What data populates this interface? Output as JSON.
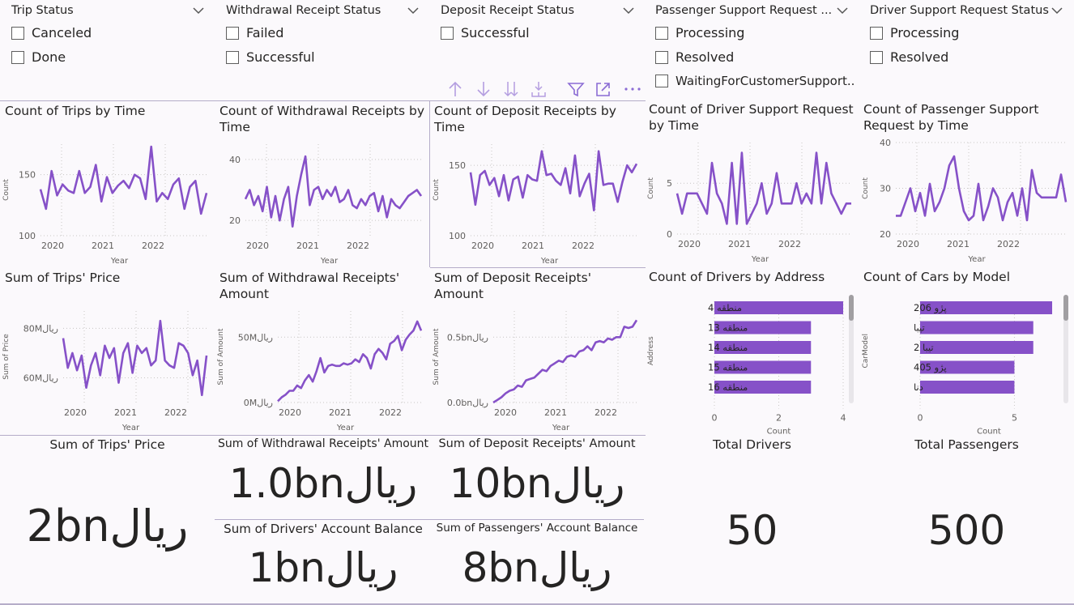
{
  "colors": {
    "accent": "#8651c8",
    "grid": "#c8c6c4",
    "text": "#605e5c",
    "divider": "#b5adc9"
  },
  "slicers": [
    {
      "title": "Trip Status",
      "options": [
        "Canceled",
        "Done"
      ]
    },
    {
      "title": "Withdrawal Receipt Status",
      "options": [
        "Failed",
        "Successful"
      ]
    },
    {
      "title": "Deposit Receipt Status",
      "options": [
        "Successful"
      ]
    },
    {
      "title": "Passenger Support Request ...",
      "options": [
        "Processing",
        "Resolved",
        "WaitingForCustomerSupport..."
      ]
    },
    {
      "title": "Driver Support Request Status",
      "options": [
        "Processing",
        "Resolved"
      ]
    }
  ],
  "toolbar_icons": [
    "arrow-up-icon",
    "arrow-down-icon",
    "double-arrow-down-icon",
    "expand-hierarchy-icon",
    "filter-icon",
    "focus-mode-icon",
    "more-options-icon"
  ],
  "visual_titles": {
    "trips_time": "Count of Trips by Time",
    "withdrawal_time": "Count of Withdrawal Receipts by Time",
    "deposit_time": "Count of Deposit Receipts by Time",
    "driver_support_time": "Count of Driver Support Request by Time",
    "passenger_support_time": "Count of Passenger Support Request by Time",
    "trips_price": "Sum of Trips' Price",
    "withdrawal_amount": "Sum of Withdrawal Receipts' Amount",
    "deposit_amount": "Sum of Deposit Receipts' Amount",
    "drivers_address": "Count of Drivers by Address",
    "cars_model": "Count of Cars by Model"
  },
  "cards": [
    {
      "title": "Sum of Trips' Price",
      "value": "2bnریال"
    },
    {
      "title": "Sum of Withdrawal Receipts' Amount",
      "value": "1.0bnریال"
    },
    {
      "title": "Sum of Deposit Receipts' Amount",
      "value": "10bnریال"
    },
    {
      "title": "Sum of Drivers' Account Balance",
      "value": "1bnریال"
    },
    {
      "title": "Sum of Passengers' Account Balance",
      "value": "8bnریال"
    },
    {
      "title": "Total Drivers",
      "value": "50"
    },
    {
      "title": "Total Passengers",
      "value": "500"
    }
  ],
  "chart_data": [
    {
      "type": "line",
      "title": "Count of Trips by Time",
      "xlabel": "Year",
      "ylabel": "Count",
      "x_ticks": [
        "2020",
        "2021",
        "2022"
      ],
      "y_ticks": [
        "100",
        "150"
      ],
      "ylim": [
        100,
        175
      ],
      "values": [
        138,
        122,
        153,
        133,
        142,
        137,
        135,
        153,
        135,
        140,
        158,
        128,
        148,
        135,
        141,
        145,
        139,
        150,
        147,
        130,
        173,
        128,
        135,
        130,
        142,
        147,
        122,
        140,
        145,
        118,
        135
      ]
    },
    {
      "type": "line",
      "title": "Count of Withdrawal Receipts by Time",
      "xlabel": "Year",
      "ylabel": "",
      "x_ticks": [
        "2020",
        "2021",
        "2022"
      ],
      "y_ticks": [
        "20",
        "40"
      ],
      "ylim": [
        15,
        45
      ],
      "values": [
        27,
        30,
        25,
        28,
        23,
        31,
        21,
        28,
        20,
        27,
        31,
        18,
        28,
        35,
        41,
        25,
        30,
        31,
        27,
        30,
        28,
        31,
        26,
        27,
        30,
        25,
        24,
        27,
        25,
        28,
        29,
        23,
        28,
        21,
        27,
        25,
        24,
        26,
        28,
        29,
        30,
        28
      ]
    },
    {
      "type": "line",
      "title": "Count of Deposit Receipts by Time",
      "xlabel": "Year",
      "ylabel": "Count",
      "x_ticks": [
        "2020",
        "2021",
        "2022"
      ],
      "y_ticks": [
        "100",
        "150"
      ],
      "ylim": [
        100,
        165
      ],
      "values": [
        145,
        122,
        143,
        146,
        136,
        141,
        128,
        143,
        125,
        140,
        142,
        127,
        143,
        140,
        139,
        160,
        143,
        144,
        139,
        136,
        148,
        130,
        157,
        128,
        137,
        144,
        118,
        160,
        136,
        137,
        137,
        124,
        138,
        150,
        145,
        151
      ]
    },
    {
      "type": "line",
      "title": "Count of Driver Support Request by Time",
      "xlabel": "Year",
      "ylabel": "Count",
      "x_ticks": [
        "2020",
        "2021",
        "2022"
      ],
      "y_ticks": [
        "0",
        "5"
      ],
      "ylim": [
        0,
        9
      ],
      "values": [
        4,
        2,
        4,
        4,
        4,
        3,
        2,
        7,
        4,
        3,
        1,
        7,
        1,
        8,
        1,
        2,
        3,
        5,
        2,
        3,
        6,
        3,
        3,
        3,
        5,
        3,
        4,
        3,
        8,
        3,
        7,
        4,
        3,
        2,
        3,
        3
      ]
    },
    {
      "type": "line",
      "title": "Count of Passenger Support Request by Time",
      "xlabel": "Year",
      "ylabel": "Count",
      "x_ticks": [
        "2020",
        "2021",
        "2022"
      ],
      "y_ticks": [
        "20",
        "30",
        "40"
      ],
      "ylim": [
        20,
        40
      ],
      "values": [
        24,
        24,
        27,
        30,
        25,
        29,
        24,
        31,
        25,
        27,
        30,
        35,
        37,
        30,
        25,
        23,
        24,
        31,
        23,
        26,
        30,
        28,
        23,
        27,
        29,
        24,
        30,
        23,
        34,
        29,
        28,
        28,
        28,
        28,
        33,
        27
      ]
    },
    {
      "type": "line",
      "title": "Sum of Trips' Price",
      "xlabel": "Year",
      "ylabel": "Sum of Price",
      "x_ticks": [
        "2020",
        "2021",
        "2022"
      ],
      "y_ticks": [
        "60Mریال",
        "80Mریال"
      ],
      "ylim": [
        50000000,
        87000000
      ],
      "values": [
        76000000,
        64000000,
        70000000,
        63000000,
        69000000,
        56000000,
        65000000,
        70000000,
        61000000,
        73000000,
        68000000,
        72000000,
        58000000,
        70000000,
        74000000,
        62000000,
        73000000,
        70000000,
        72000000,
        65000000,
        67000000,
        83000000,
        67000000,
        65000000,
        64000000,
        74000000,
        73000000,
        70000000,
        61000000,
        67000000,
        53000000,
        69000000
      ]
    },
    {
      "type": "line",
      "title": "Sum of Withdrawal Receipts' Amount",
      "xlabel": "Year",
      "ylabel": "Sum of Amount",
      "x_ticks": [
        "2020",
        "2021",
        "2022"
      ],
      "y_ticks": [
        "0Mریال",
        "50Mریال"
      ],
      "ylim": [
        0,
        70000000
      ],
      "values": [
        1000000,
        4000000,
        6000000,
        9000000,
        9000000,
        13000000,
        11000000,
        17000000,
        21000000,
        16000000,
        24000000,
        34000000,
        23000000,
        28000000,
        29000000,
        28000000,
        28000000,
        30000000,
        29000000,
        30000000,
        33000000,
        31000000,
        37000000,
        34000000,
        26000000,
        37000000,
        41000000,
        38000000,
        33000000,
        45000000,
        47000000,
        51000000,
        40000000,
        48000000,
        52000000,
        55000000,
        62000000,
        55000000
      ]
    },
    {
      "type": "line",
      "title": "Sum of Deposit Receipts' Amount",
      "xlabel": "Year",
      "ylabel": "Sum of Amount",
      "x_ticks": [
        "2020",
        "2021",
        "2022"
      ],
      "y_ticks": [
        "0.0bnریال",
        "0.5bnریال"
      ],
      "ylim": [
        0,
        0.7
      ],
      "values": [
        0.0,
        0.02,
        0.04,
        0.07,
        0.09,
        0.1,
        0.13,
        0.12,
        0.17,
        0.18,
        0.19,
        0.22,
        0.25,
        0.24,
        0.28,
        0.3,
        0.32,
        0.31,
        0.35,
        0.36,
        0.35,
        0.39,
        0.4,
        0.43,
        0.4,
        0.46,
        0.47,
        0.46,
        0.49,
        0.48,
        0.5,
        0.5,
        0.58,
        0.57,
        0.58,
        0.63
      ]
    },
    {
      "type": "bar",
      "title": "Count of Drivers by Address",
      "xlabel": "Count",
      "ylabel": "Address",
      "categories": [
        "منطقه 4",
        "منطقه 13",
        "منطقه 14",
        "منطقه 15",
        "منطقه 16"
      ],
      "values": [
        4,
        3,
        3,
        3,
        3
      ],
      "x_ticks": [
        "0",
        "2",
        "4"
      ],
      "xlim": [
        0,
        4
      ]
    },
    {
      "type": "bar",
      "title": "Count of Cars by Model",
      "xlabel": "Count",
      "ylabel": "CarModel",
      "categories": [
        "پژو 206",
        "تیبا",
        "تیبا 2",
        "پژو 405",
        "دنا"
      ],
      "values": [
        7,
        6,
        6,
        5,
        5
      ],
      "x_ticks": [
        "0",
        "5"
      ],
      "xlim": [
        0,
        7.3
      ]
    }
  ]
}
